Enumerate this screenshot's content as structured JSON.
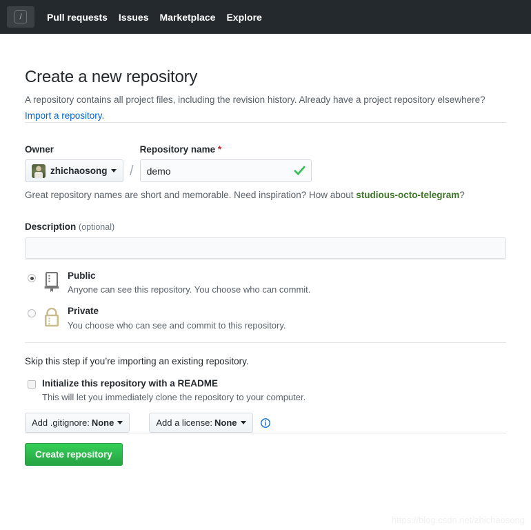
{
  "header": {
    "search_shortcut": "/",
    "search_icon": "search-slash-icon",
    "nav": [
      {
        "label": "Pull requests"
      },
      {
        "label": "Issues"
      },
      {
        "label": "Marketplace"
      },
      {
        "label": "Explore"
      }
    ]
  },
  "page": {
    "title": "Create a new repository",
    "lede": "A repository contains all project files, including the revision history. Already have a project repository elsewhere?",
    "import_link": "Import a repository."
  },
  "owner": {
    "label": "Owner",
    "name": "zhichaosong",
    "avatar_icon": "user-avatar",
    "caret_icon": "chevron-down-icon",
    "separator": "/"
  },
  "repo_name": {
    "label": "Repository name",
    "required_marker": "*",
    "value": "demo",
    "placeholder": "",
    "valid_icon": "check-icon",
    "valid_color": "#2cbe4e"
  },
  "inspiration": {
    "prefix": "Great repository names are short and memorable. Need inspiration? How about ",
    "suggestion": "studious-octo-telegram",
    "suffix": "?",
    "suggestion_color": "#3c7527"
  },
  "description": {
    "label": "Description",
    "optional": "(optional)",
    "value": "",
    "placeholder": ""
  },
  "visibility": {
    "options": [
      {
        "id": "public",
        "title": "Public",
        "desc": "Anyone can see this repository. You choose who can commit.",
        "icon": "repo-book-icon",
        "icon_color": "#767676",
        "selected": true
      },
      {
        "id": "private",
        "title": "Private",
        "desc": "You choose who can see and commit to this repository.",
        "icon": "lock-icon",
        "icon_color": "#c9bd8b",
        "selected": false
      }
    ]
  },
  "initialize": {
    "skip_text": "Skip this step if you’re importing an existing repository.",
    "checkbox_label": "Initialize this repository with a README",
    "checkbox_desc": "This will let you immediately clone the repository to your computer.",
    "checked": false
  },
  "templates": {
    "gitignore_prefix": "Add .gitignore:",
    "gitignore_value": "None",
    "license_prefix": "Add a license:",
    "license_value": "None",
    "caret_icon": "chevron-down-icon",
    "info_icon": "info-circle-icon",
    "info_color": "#0366d6"
  },
  "submit": {
    "label": "Create repository",
    "color": "#2cbe4e"
  },
  "watermark": {
    "text": "https://blog.csdn.net/zhichaosong"
  }
}
